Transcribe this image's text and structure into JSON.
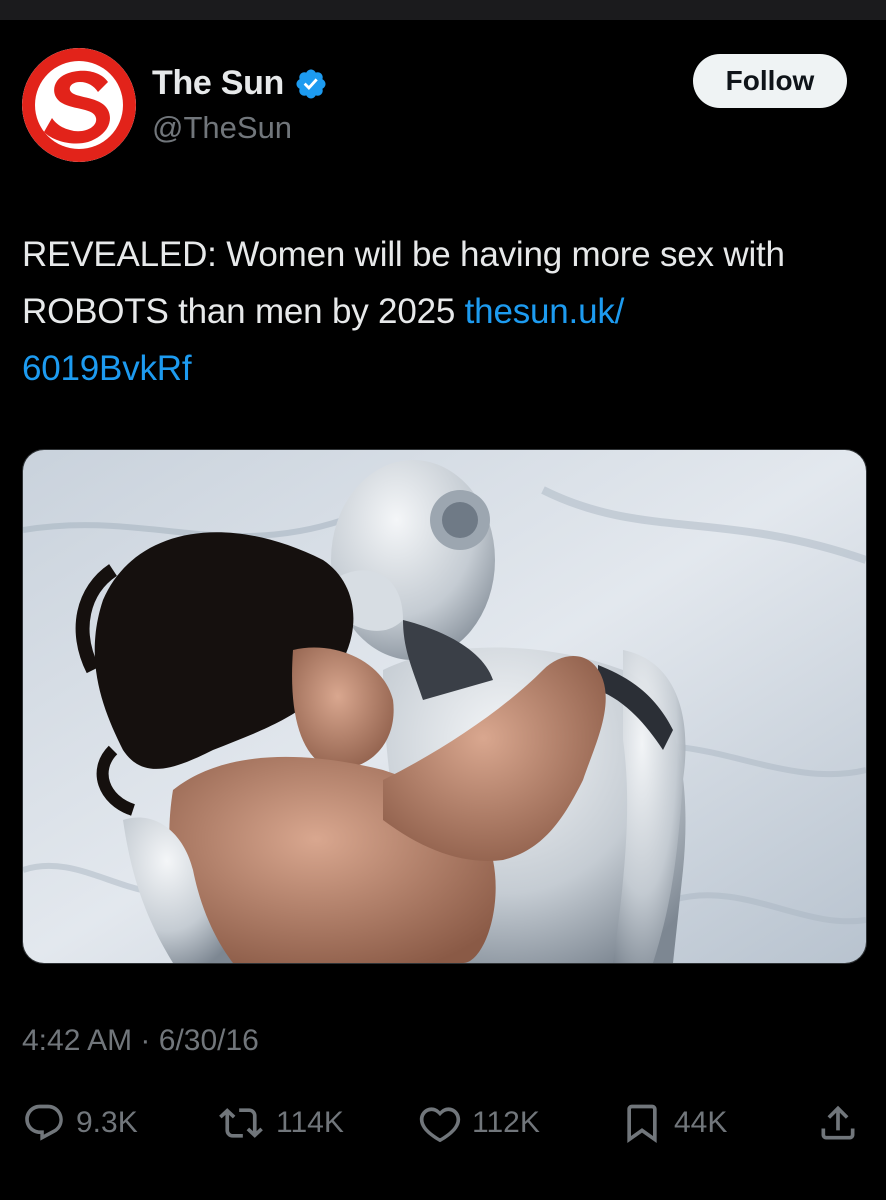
{
  "account": {
    "name": "The Sun",
    "handle": "@TheSun",
    "verified_icon": "verified-badge-icon",
    "avatar_icon": "the-sun-logo",
    "logo_letter": "S"
  },
  "follow_label": "Follow",
  "tweet": {
    "text": "REVEALED: Women will be having more sex with ROBOTS than men by 2025 ",
    "link": "thesun.uk/6019BvkRf",
    "link_line1": "thesun.uk/",
    "link_line2": "6019BvkRf",
    "timestamp": "4:42 AM",
    "separator": "·",
    "date": "6/30/16"
  },
  "stats": {
    "replies": "9.3K",
    "retweets": "114K",
    "likes": "112K",
    "bookmarks": "44K"
  },
  "icons": {
    "reply": "reply-icon",
    "retweet": "retweet-icon",
    "like": "heart-icon",
    "bookmark": "bookmark-icon",
    "share": "share-icon"
  },
  "colors": {
    "background": "#000000",
    "text": "#e7e9ea",
    "muted": "#71767b",
    "link": "#1d9bf0",
    "brand_red": "#e2231a",
    "verified_blue": "#1d9bf0",
    "follow_bg": "#eff3f4"
  }
}
